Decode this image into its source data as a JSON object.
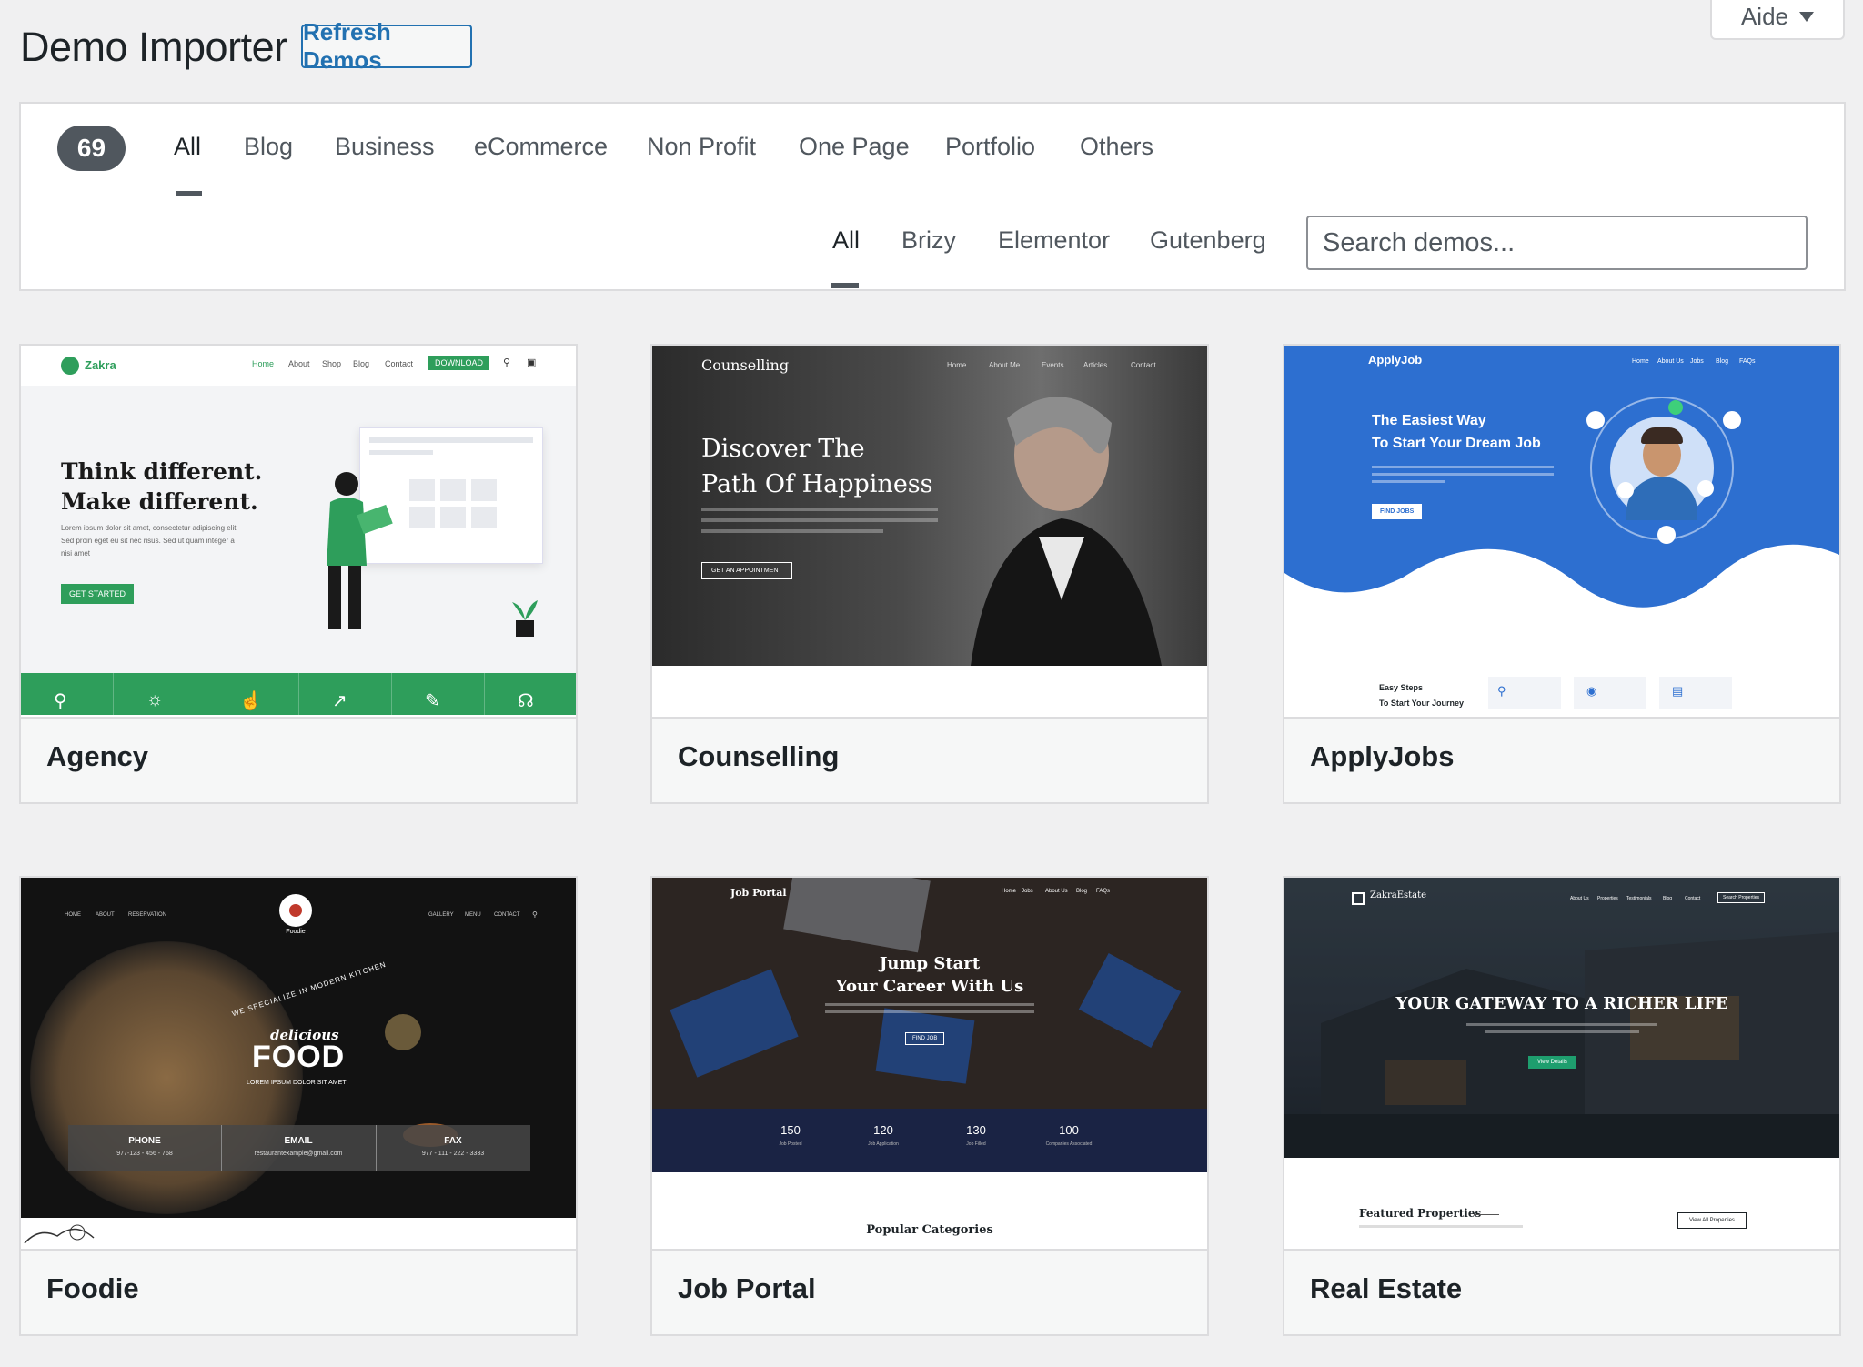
{
  "header": {
    "title": "Demo Importer",
    "refresh_label": "Refresh Demos",
    "help_label": "Aide"
  },
  "filters": {
    "count": "69",
    "categories": [
      "All",
      "Blog",
      "Business",
      "eCommerce",
      "Non Profit",
      "One Page",
      "Portfolio",
      "Others"
    ],
    "active_category": "All",
    "builders": [
      "All",
      "Brizy",
      "Elementor",
      "Gutenberg"
    ],
    "active_builder": "All",
    "search_placeholder": "Search demos..."
  },
  "demos": [
    {
      "name": "Agency",
      "preview": {
        "logo": "Zakra",
        "nav": [
          "Home",
          "About",
          "Shop",
          "Blog",
          "Contact"
        ],
        "nav_button": "DOWNLOAD",
        "headline1": "Think different.",
        "headline2": "Make different.",
        "body": "Lorem ipsum dolor sit amet, consectetur adipiscing elit. Sed proin eget eu sit nec risus. Sed ut quam integer a nisi amet",
        "cta": "GET STARTED"
      }
    },
    {
      "name": "Counselling",
      "preview": {
        "logo": "Counselling",
        "nav": [
          "Home",
          "About Me",
          "Events",
          "Articles",
          "Contact"
        ],
        "headline1": "Discover The",
        "headline2": "Path Of Happiness",
        "cta": "GET AN APPOINTMENT"
      }
    },
    {
      "name": "ApplyJobs",
      "preview": {
        "logo": "ApplyJob",
        "nav": [
          "Home",
          "About Us",
          "Jobs",
          "Blog",
          "FAQs"
        ],
        "headline1": "The Easiest Way",
        "headline2": "To Start Your Dream Job",
        "cta": "FIND JOBS",
        "steps1": "Easy Steps",
        "steps2": "To Start Your Journey"
      }
    },
    {
      "name": "Foodie",
      "preview": {
        "nav_left": [
          "HOME",
          "ABOUT",
          "RESERVATION"
        ],
        "nav_right": [
          "GALLERY",
          "MENU",
          "CONTACT"
        ],
        "logo": "Foodie",
        "arc": "WE SPECIALIZE IN MODERN KITCHEN",
        "script": "delicious",
        "headline": "FOOD",
        "sub": "LOREM IPSUM DOLOR SIT AMET",
        "contacts": [
          {
            "label": "PHONE",
            "value": "977-123 - 456 - 768"
          },
          {
            "label": "EMAIL",
            "value": "restaurantexample@gmail.com"
          },
          {
            "label": "FAX",
            "value": "977 - 111 - 222 - 3333"
          }
        ]
      }
    },
    {
      "name": "Job Portal",
      "preview": {
        "logo": "Job Portal",
        "nav": [
          "Home",
          "Jobs",
          "About Us",
          "Blog",
          "FAQs"
        ],
        "headline1": "Jump Start",
        "headline2": "Your Career With Us",
        "cta": "FIND JOB",
        "stats": [
          {
            "value": "150",
            "label": "Job Posted"
          },
          {
            "value": "120",
            "label": "Job Application"
          },
          {
            "value": "130",
            "label": "Job Filled"
          },
          {
            "value": "100",
            "label": "Companies Associated"
          }
        ],
        "section": "Popular Categories"
      }
    },
    {
      "name": "Real Estate",
      "preview": {
        "logo": "ZakraEstate",
        "nav": [
          "About Us",
          "Properties",
          "Testimonials",
          "Blog",
          "Contact"
        ],
        "nav_button": "Search Properties",
        "headline": "YOUR GATEWAY TO A RICHER LIFE",
        "cta": "View Details",
        "section": "Featured Properties",
        "section_button": "View All Properties"
      }
    }
  ],
  "colors": {
    "accent": "#2271b1",
    "badge": "#50575e",
    "agency_green": "#2e9e5b",
    "applyjob_blue": "#2d6fd0",
    "jobportal_navy": "#1a2344"
  }
}
